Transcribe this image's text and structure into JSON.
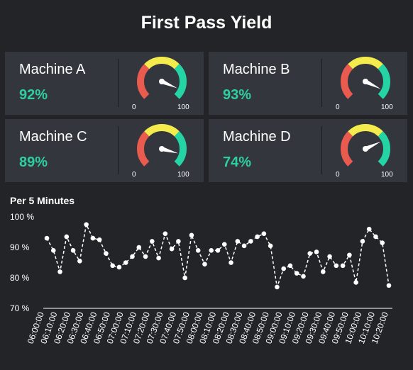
{
  "title": "First Pass Yield",
  "machines": [
    {
      "name": "Machine A",
      "value_label": "92%",
      "value": 92,
      "min_label": "0",
      "max_label": "100"
    },
    {
      "name": "Machine B",
      "value_label": "93%",
      "value": 93,
      "min_label": "0",
      "max_label": "100"
    },
    {
      "name": "Machine C",
      "value_label": "89%",
      "value": 89,
      "min_label": "0",
      "max_label": "100"
    },
    {
      "name": "Machine D",
      "value_label": "74%",
      "value": 74,
      "min_label": "0",
      "max_label": "100"
    }
  ],
  "colors": {
    "background": "#232427",
    "card": "#33373d",
    "value_green": "#2ecf9e",
    "gauge_red": "#e95a4f",
    "gauge_yellow": "#f4ec4d",
    "gauge_green": "#25d4a4"
  },
  "chart_data": {
    "type": "line",
    "title": "Per 5 Minutes",
    "ylim": [
      70,
      100
    ],
    "y_ticks": [
      "100 %",
      "90 %",
      "80 %",
      "70 %"
    ],
    "y_tick_values": [
      100,
      90,
      80,
      70
    ],
    "x_tick_labels": [
      "06:00:00",
      "06:10:00",
      "06:20:00",
      "06:30:00",
      "06:40:00",
      "06:50:00",
      "07:00:00",
      "07:10:00",
      "07:20:00",
      "07:30:00",
      "07:40:00",
      "07:50:00",
      "08:00:00",
      "08:10:00",
      "08:20:00",
      "08:30:00",
      "08:40:00",
      "08:50:00",
      "09:00:00",
      "09:10:00",
      "09:20:00",
      "09:30:00",
      "09:40:00",
      "09:50:00",
      "10:00:00",
      "10:10:00",
      "10:20:00"
    ],
    "series": [
      {
        "values": [
          93,
          89,
          82,
          93.5,
          89,
          85.5,
          97.5,
          93,
          92.5,
          88,
          84,
          83.5,
          85,
          87,
          90,
          87,
          92,
          86.5,
          94.5,
          89.5,
          92,
          80,
          94,
          89,
          84.5,
          89,
          89,
          91,
          85,
          92,
          90.5,
          92,
          93.5,
          94.5,
          90.5,
          77,
          83,
          84,
          81.5,
          80.5,
          88,
          88.5,
          82,
          87,
          84,
          84,
          87.5,
          78.5,
          92,
          96,
          93.5,
          91.5,
          77.5
        ],
        "style": "dashed"
      }
    ],
    "grid": false
  }
}
